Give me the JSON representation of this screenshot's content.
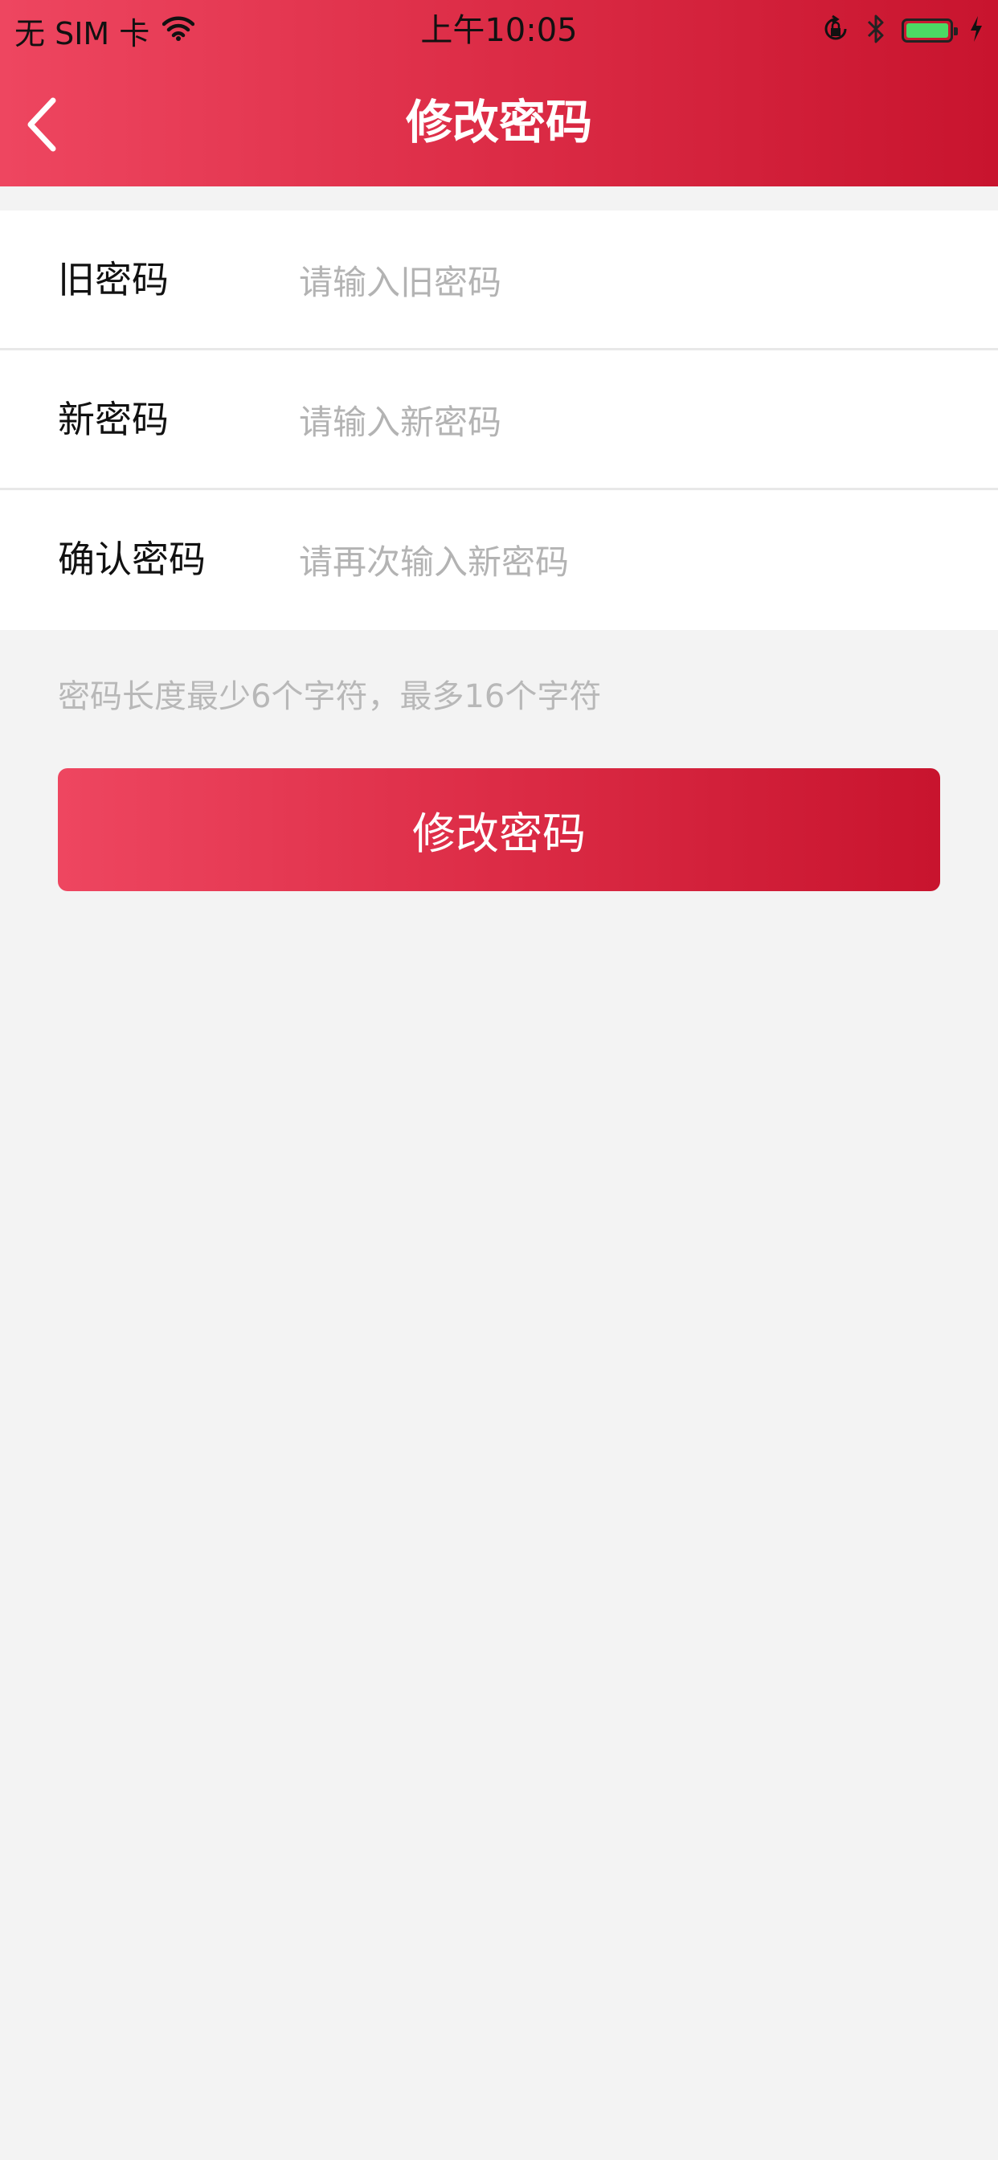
{
  "status_bar": {
    "carrier": "无 SIM 卡",
    "time": "上午10:05",
    "wifi_icon": "wifi-icon",
    "rotation_lock_icon": "rotation-lock-icon",
    "bluetooth_icon": "bluetooth-icon",
    "battery_level": 1.0,
    "charging_icon": "charging-bolt-icon"
  },
  "nav": {
    "back_icon": "chevron-left-icon",
    "title": "修改密码"
  },
  "form": {
    "old_password": {
      "label": "旧密码",
      "value": "",
      "placeholder": "请输入旧密码"
    },
    "new_password": {
      "label": "新密码",
      "value": "",
      "placeholder": "请输入新密码"
    },
    "confirm_password": {
      "label": "确认密码",
      "value": "",
      "placeholder": "请再次输入新密码"
    }
  },
  "hint": "密码长度最少6个字符，最多16个字符",
  "submit_label": "修改密码",
  "colors": {
    "accent_start": "#ee4660",
    "accent_end": "#c8142e",
    "page_background": "#f3f3f3",
    "placeholder": "#b3b3b3",
    "battery": "#4cd964"
  }
}
